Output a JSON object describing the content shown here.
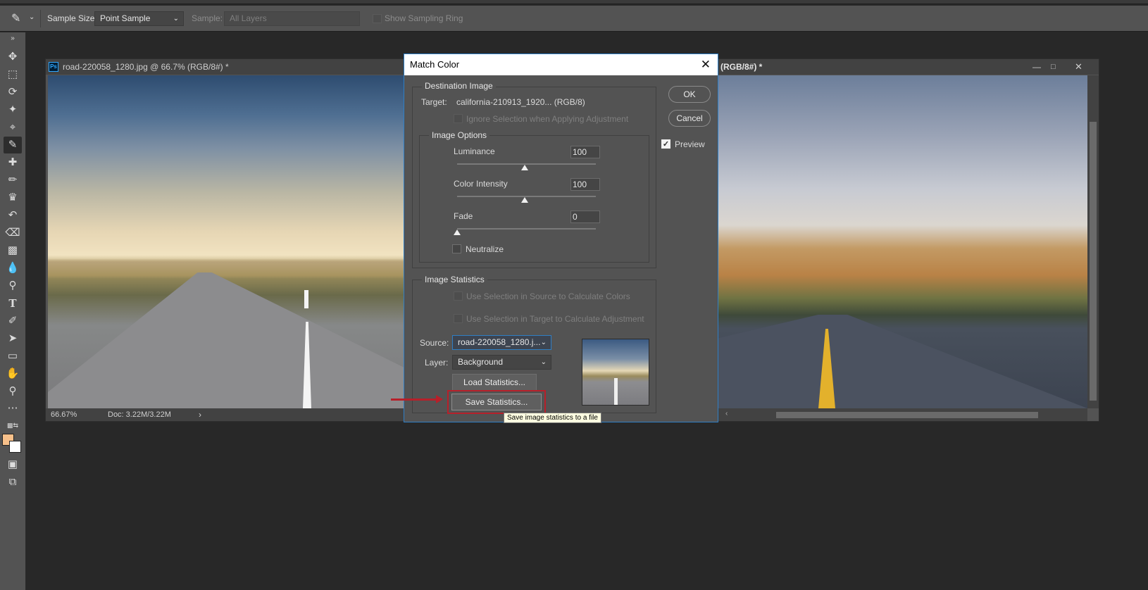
{
  "options_bar": {
    "sample_size_label": "Sample Size:",
    "sample_size_value": "Point Sample",
    "sample_label": "Sample:",
    "sample_value": "All Layers",
    "show_sampling_ring_label": "Show Sampling Ring"
  },
  "documents": {
    "left": {
      "title": "road-220058_1280.jpg @ 66.7% (RGB/8#) *",
      "zoom": "66.67%",
      "doc_info": "Doc: 3.22M/3.22M"
    },
    "right": {
      "title": "(RGB/8#) *"
    }
  },
  "dialog": {
    "title": "Match Color",
    "ok": "OK",
    "cancel": "Cancel",
    "preview": "Preview",
    "destination": {
      "title": "Destination Image",
      "target_label": "Target:",
      "target_value": "california-210913_1920... (RGB/8)",
      "ignore_selection": "Ignore Selection when Applying Adjustment",
      "image_options": {
        "title": "Image Options",
        "luminance_label": "Luminance",
        "luminance_value": "100",
        "color_intensity_label": "Color Intensity",
        "color_intensity_value": "100",
        "fade_label": "Fade",
        "fade_value": "0",
        "neutralize": "Neutralize"
      }
    },
    "statistics": {
      "title": "Image Statistics",
      "use_sel_source": "Use Selection in Source to Calculate Colors",
      "use_sel_target": "Use Selection in Target to Calculate Adjustment",
      "source_label": "Source:",
      "source_value": "road-220058_1280.j...",
      "layer_label": "Layer:",
      "layer_value": "Background",
      "load_stats": "Load Statistics...",
      "save_stats": "Save Statistics..."
    },
    "tooltip": "Save image statistics to a file"
  },
  "colors": {
    "foreground": "#f7c08a",
    "background": "#ffffff",
    "highlight": "#b7202a",
    "dialog_border": "#2f7ec4"
  },
  "slider_values": {
    "luminance": 1.0,
    "color_intensity": 1.0,
    "fade": 0
  }
}
